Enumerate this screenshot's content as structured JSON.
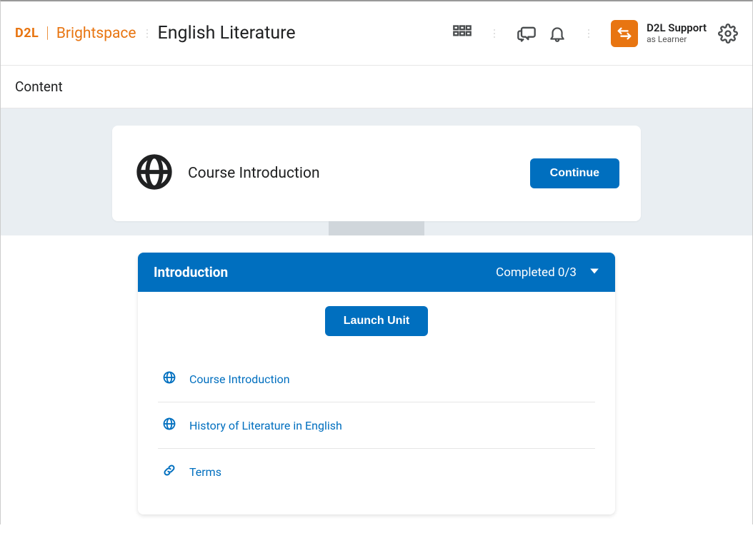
{
  "header": {
    "logo_brand": "D2L",
    "logo_product": "Brightspace",
    "course_title": "English Literature",
    "user_name": "D2L Support",
    "user_role": "as Learner"
  },
  "nav": {
    "content_tab": "Content"
  },
  "intro_card": {
    "title": "Course Introduction",
    "continue_label": "Continue"
  },
  "module": {
    "title": "Introduction",
    "progress": "Completed 0/3",
    "launch_label": "Launch Unit",
    "items": [
      {
        "icon": "globe",
        "label": "Course Introduction"
      },
      {
        "icon": "globe",
        "label": "History of Literature in English"
      },
      {
        "icon": "link",
        "label": "Terms"
      }
    ]
  }
}
